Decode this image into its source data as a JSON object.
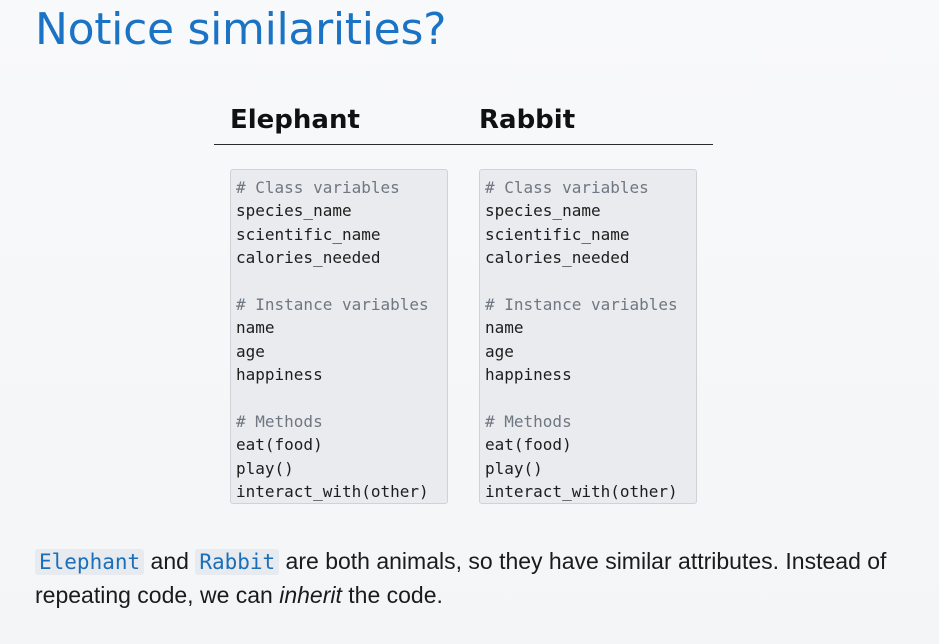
{
  "slide": {
    "title": "Notice similarities?"
  },
  "table": {
    "columns": [
      {
        "header": "Elephant",
        "lines": [
          {
            "text": "# Class variables",
            "type": "comment"
          },
          {
            "text": "species_name",
            "type": "code"
          },
          {
            "text": "scientific_name",
            "type": "code"
          },
          {
            "text": "calories_needed",
            "type": "code"
          },
          {
            "text": "",
            "type": "blank"
          },
          {
            "text": "# Instance variables",
            "type": "comment"
          },
          {
            "text": "name",
            "type": "code"
          },
          {
            "text": "age",
            "type": "code"
          },
          {
            "text": "happiness",
            "type": "code"
          },
          {
            "text": "",
            "type": "blank"
          },
          {
            "text": "# Methods",
            "type": "comment"
          },
          {
            "text": "eat(food)",
            "type": "code"
          },
          {
            "text": "play()",
            "type": "code"
          },
          {
            "text": "interact_with(other)",
            "type": "code"
          }
        ]
      },
      {
        "header": "Rabbit",
        "lines": [
          {
            "text": "# Class variables",
            "type": "comment"
          },
          {
            "text": "species_name",
            "type": "code"
          },
          {
            "text": "scientific_name",
            "type": "code"
          },
          {
            "text": "calories_needed",
            "type": "code"
          },
          {
            "text": "",
            "type": "blank"
          },
          {
            "text": "# Instance variables",
            "type": "comment"
          },
          {
            "text": "name",
            "type": "code"
          },
          {
            "text": "age",
            "type": "code"
          },
          {
            "text": "happiness",
            "type": "code"
          },
          {
            "text": "",
            "type": "blank"
          },
          {
            "text": "# Methods",
            "type": "comment"
          },
          {
            "text": "eat(food)",
            "type": "code"
          },
          {
            "text": "play()",
            "type": "code"
          },
          {
            "text": "interact_with(other)",
            "type": "code"
          }
        ]
      }
    ]
  },
  "footer": {
    "code_1": "Elephant",
    "text_1": " and ",
    "code_2": "Rabbit",
    "text_2": " are both animals, so they have similar attributes. Instead of repeating code, we can ",
    "emphasis": "inherit",
    "text_3": " the code."
  },
  "colors": {
    "title": "#1a73c4",
    "inline_code": "#1a6fb8",
    "code_background": "#e9ebee",
    "comment": "#6f7782"
  }
}
